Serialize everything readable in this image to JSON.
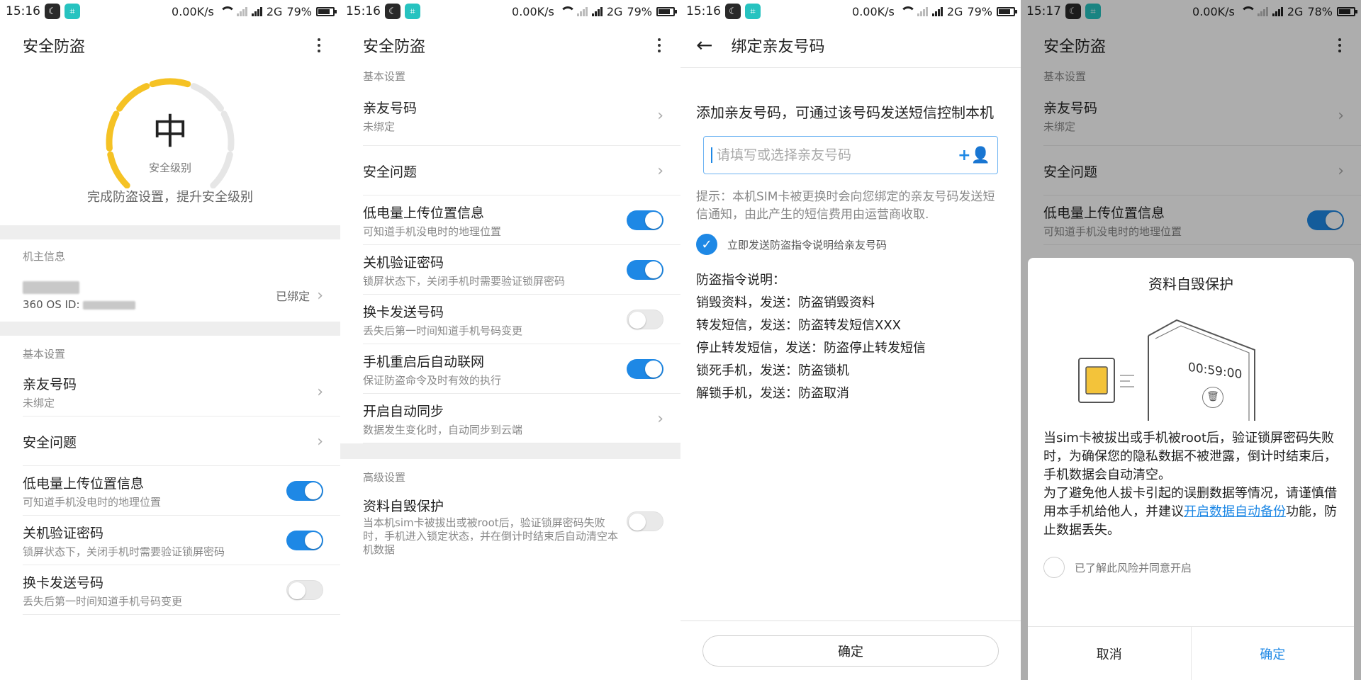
{
  "status_bars": [
    {
      "time": "15:16",
      "speed": "0.00K/s",
      "network": "2G",
      "battery": "79%",
      "battery_level": 0.79
    },
    {
      "time": "15:16",
      "speed": "0.00K/s",
      "network": "2G",
      "battery": "79%",
      "battery_level": 0.79
    },
    {
      "time": "15:16",
      "speed": "0.00K/s",
      "network": "2G",
      "battery": "79%",
      "battery_level": 0.79
    },
    {
      "time": "15:17",
      "speed": "0.00K/s",
      "network": "2G",
      "battery": "78%",
      "battery_level": 0.78
    }
  ],
  "icons": {
    "status_app1": "moon-icon",
    "status_app2": "scan-icon",
    "more": "more-vertical-icon",
    "back": "arrow-left-icon",
    "chevron": "chevron-right-icon",
    "add_contact": "add-contact-icon",
    "check": "check-icon"
  },
  "colors": {
    "accent": "#1e88e5",
    "gauge_active": "#f5c224",
    "gauge_inactive": "#e6e6e6",
    "toggle_off": "#e9e9e9"
  },
  "screen1": {
    "title": "安全防盗",
    "gauge": {
      "level": "中",
      "caption": "安全级别",
      "filled_segments": 4,
      "total_segments": 7
    },
    "hint": "完成防盗设置，提升安全级别",
    "owner_section": "机主信息",
    "owner": {
      "id_label": "360 OS ID:",
      "status": "已绑定"
    },
    "basic_section": "基本设置",
    "items": [
      {
        "title": "亲友号码",
        "sub": "未绑定",
        "control": "chevron"
      },
      {
        "title": "安全问题",
        "sub": "",
        "control": "chevron"
      },
      {
        "title": "低电量上传位置信息",
        "sub": "可知道手机没电时的地理位置",
        "control": "toggle",
        "on": true
      },
      {
        "title": "关机验证密码",
        "sub": "锁屏状态下，关闭手机时需要验证锁屏密码",
        "control": "toggle",
        "on": true
      },
      {
        "title": "换卡发送号码",
        "sub": "丢失后第一时间知道手机号码变更",
        "control": "toggle",
        "on": false
      }
    ]
  },
  "screen2": {
    "title": "安全防盗",
    "basic_section": "基本设置",
    "items": [
      {
        "title": "亲友号码",
        "sub": "未绑定",
        "control": "chevron"
      },
      {
        "title": "安全问题",
        "sub": "",
        "control": "chevron"
      },
      {
        "title": "低电量上传位置信息",
        "sub": "可知道手机没电时的地理位置",
        "control": "toggle",
        "on": true
      },
      {
        "title": "关机验证密码",
        "sub": "锁屏状态下，关闭手机时需要验证锁屏密码",
        "control": "toggle",
        "on": true
      },
      {
        "title": "换卡发送号码",
        "sub": "丢失后第一时间知道手机号码变更",
        "control": "toggle",
        "on": false
      },
      {
        "title": "手机重启后自动联网",
        "sub": "保证防盗命令及时有效的执行",
        "control": "toggle",
        "on": true
      },
      {
        "title": "开启自动同步",
        "sub": "数据发生变化时，自动同步到云端",
        "control": "chevron"
      }
    ],
    "advanced_section": "高级设置",
    "advanced_item": {
      "title": "资料自毁保护",
      "sub": "当本机sim卡被拔出或被root后，验证锁屏密码失败时，手机进入锁定状态，并在倒计时结束后自动清空本机数据",
      "on": false
    }
  },
  "screen3": {
    "title": "绑定亲友号码",
    "heading": "添加亲友号码，可通过该号码发送短信控制本机",
    "input_placeholder": "请填写或选择亲友号码",
    "input_value": "",
    "tip": "提示：本机SIM卡被更换时会向您绑定的亲友号码发送短信通知，由此产生的短信费用由运营商收取.",
    "check_label": "立即发送防盗指令说明给亲友号码",
    "checked": true,
    "commands_title": "防盗指令说明：",
    "commands": [
      "销毁资料，发送：防盗销毁资料",
      "转发短信，发送：防盗转发短信XXX",
      "停止转发短信，发送：防盗停止转发短信",
      "锁死手机，发送：防盗锁机",
      "解锁手机，发送：防盗取消"
    ],
    "confirm": "确定"
  },
  "screen4": {
    "title": "安全防盗",
    "basic_section": "基本设置",
    "items": [
      {
        "title": "亲友号码",
        "sub": "未绑定",
        "control": "chevron"
      },
      {
        "title": "安全问题",
        "sub": "",
        "control": "chevron"
      },
      {
        "title": "低电量上传位置信息",
        "sub": "可知道手机没电时的地理位置",
        "control": "toggle",
        "on": true
      }
    ],
    "dialog": {
      "title": "资料自毁保护",
      "timer": "00:59:00",
      "body_1": "当sim卡被拔出或手机被root后，验证锁屏密码失败时，为确保您的隐私数据不被泄露，倒计时结束后，手机数据会自动清空。",
      "body_2_pre": "为了避免他人拔卡引起的误删数据等情况，请谨慎借用本手机给他人，并建议",
      "body_2_link": "开启数据自动备份",
      "body_2_post": "功能，防止数据丢失。",
      "check_label": "已了解此风险并同意开启",
      "cancel": "取消",
      "confirm": "确定"
    }
  }
}
